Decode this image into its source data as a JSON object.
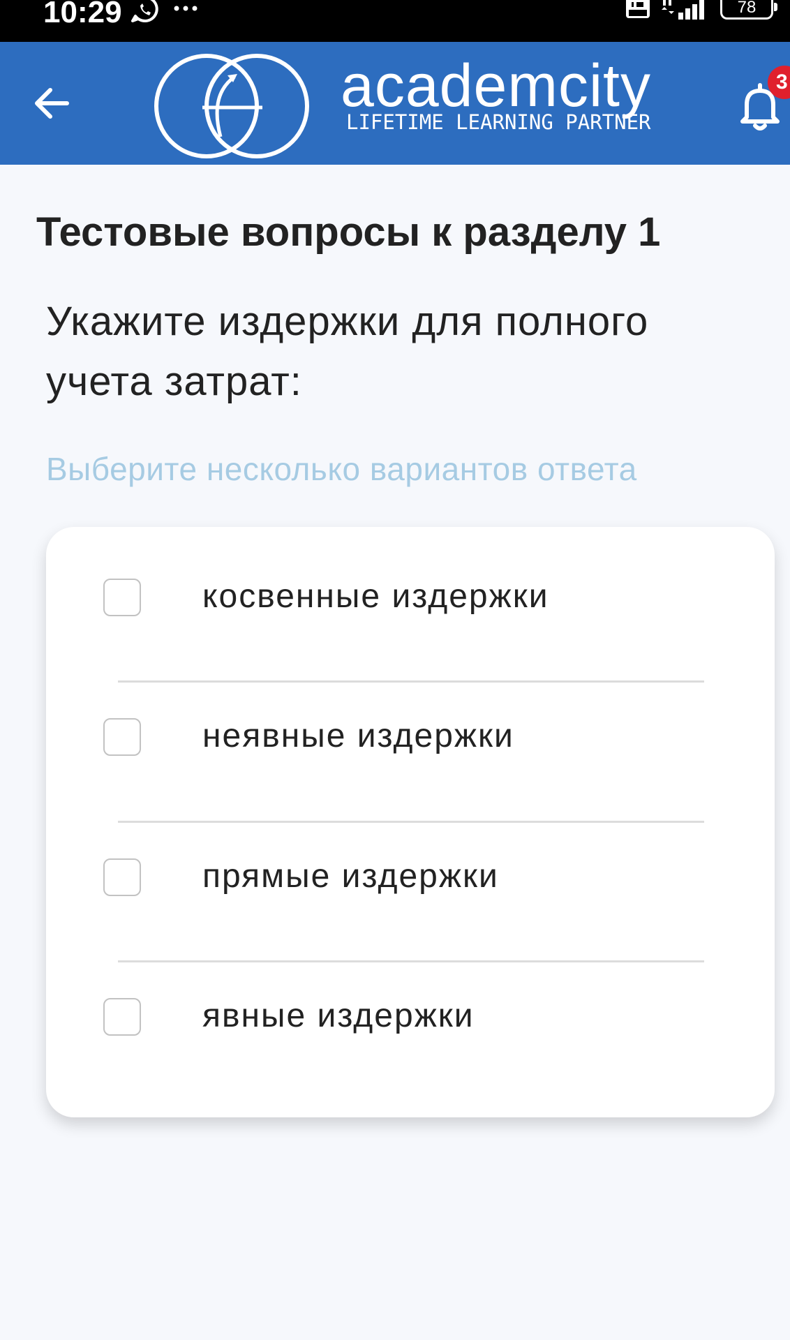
{
  "status_bar": {
    "time": "10:29",
    "battery": "78",
    "icons": [
      "whatsapp-icon",
      "more-icon",
      "volte-icon",
      "signal-4g-icon",
      "battery-icon"
    ]
  },
  "header": {
    "background": "#2d6dbf",
    "logo_word": "academcity",
    "logo_tagline": "LIFETIME LEARNING PARTNER",
    "notification_count": "3",
    "icons": [
      "back-arrow-icon",
      "academcity-logo-icon",
      "bell-icon"
    ]
  },
  "test": {
    "section_title": "Тестовые вопросы к разделу 1",
    "question": "Укажите издержки для полного учета затрат:",
    "hint": "Выберите несколько вариантов ответа",
    "hint_color": "#a6cbe3",
    "options": [
      {
        "label": "косвенные издержки",
        "checked": false
      },
      {
        "label": "неявные издержки",
        "checked": false
      },
      {
        "label": "прямые издержки",
        "checked": false
      },
      {
        "label": "явные издержки",
        "checked": false
      }
    ]
  }
}
